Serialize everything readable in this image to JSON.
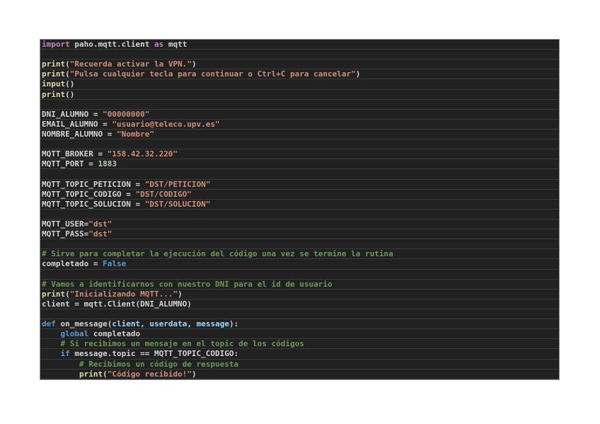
{
  "page": {
    "background": "#ffffff"
  },
  "editor": {
    "language": "python",
    "background": "#212121",
    "rule_color": "#3a3a3a",
    "border_color": "#8f8f8f",
    "colors": {
      "plain": "#d4d4d4",
      "keyword": "#c586c0",
      "control": "#569cd6",
      "function": "#dcdcaa",
      "string": "#ce9178",
      "number": "#b5cea8",
      "comment": "#6a9955",
      "param": "#9cdcfe"
    },
    "lines": [
      {
        "s": [
          [
            "import",
            "keyword"
          ],
          [
            " paho.mqtt.client ",
            "plain"
          ],
          [
            "as",
            "keyword"
          ],
          [
            " mqtt",
            "plain"
          ]
        ]
      },
      {
        "s": []
      },
      {
        "s": [
          [
            "print",
            "function"
          ],
          [
            "(",
            "plain"
          ],
          [
            "\"Recuerda activar la VPN.\"",
            "string"
          ],
          [
            ")",
            "plain"
          ]
        ]
      },
      {
        "s": [
          [
            "print",
            "function"
          ],
          [
            "(",
            "plain"
          ],
          [
            "\"Pulsa cualquier tecla para continuar o Ctrl+C para cancelar\"",
            "string"
          ],
          [
            ")",
            "plain"
          ]
        ]
      },
      {
        "s": [
          [
            "input",
            "function"
          ],
          [
            "()",
            "plain"
          ]
        ]
      },
      {
        "s": [
          [
            "print",
            "function"
          ],
          [
            "()",
            "plain"
          ]
        ]
      },
      {
        "s": []
      },
      {
        "s": [
          [
            "DNI_ALUMNO = ",
            "plain"
          ],
          [
            "\"00000000\"",
            "string"
          ]
        ]
      },
      {
        "s": [
          [
            "EMAIL_ALUMNO = ",
            "plain"
          ],
          [
            "\"usuario@teleco.upv.es\"",
            "string"
          ]
        ]
      },
      {
        "s": [
          [
            "NOMBRE_ALUMNO = ",
            "plain"
          ],
          [
            "\"Nombre\"",
            "string"
          ]
        ]
      },
      {
        "s": []
      },
      {
        "s": [
          [
            "MQTT_BROKER = ",
            "plain"
          ],
          [
            "\"158.42.32.220\"",
            "string"
          ]
        ]
      },
      {
        "s": [
          [
            "MQTT_PORT = ",
            "plain"
          ],
          [
            "1883",
            "number"
          ]
        ]
      },
      {
        "s": []
      },
      {
        "s": [
          [
            "MQTT_TOPIC_PETICION = ",
            "plain"
          ],
          [
            "\"DST/PETICION\"",
            "string"
          ]
        ]
      },
      {
        "s": [
          [
            "MQTT_TOPIC_CODIGO = ",
            "plain"
          ],
          [
            "\"DST/CODIGO\"",
            "string"
          ]
        ]
      },
      {
        "s": [
          [
            "MQTT_TOPIC_SOLUCION = ",
            "plain"
          ],
          [
            "\"DST/SOLUCION\"",
            "string"
          ]
        ]
      },
      {
        "s": []
      },
      {
        "s": [
          [
            "MQTT_USER=",
            "plain"
          ],
          [
            "\"dst\"",
            "string"
          ]
        ]
      },
      {
        "s": [
          [
            "MQTT_PASS=",
            "plain"
          ],
          [
            "\"dst\"",
            "string"
          ]
        ]
      },
      {
        "s": []
      },
      {
        "s": [
          [
            "# Sirve para completar la ejecución del código una vez se termine la rutina",
            "comment"
          ]
        ]
      },
      {
        "s": [
          [
            "completado = ",
            "plain"
          ],
          [
            "False",
            "control"
          ]
        ]
      },
      {
        "s": []
      },
      {
        "s": [
          [
            "# Vamos a identificarnos con nuestro DNI para el id de usuario",
            "comment"
          ]
        ]
      },
      {
        "s": [
          [
            "print",
            "function"
          ],
          [
            "(",
            "plain"
          ],
          [
            "\"Inicializando MQTT...\"",
            "string"
          ],
          [
            ")",
            "plain"
          ]
        ]
      },
      {
        "s": [
          [
            "client = mqtt.Client(DNI_ALUMNO)",
            "plain"
          ]
        ]
      },
      {
        "s": []
      },
      {
        "s": [
          [
            "def",
            "control"
          ],
          [
            " ",
            "plain"
          ],
          [
            "on_message",
            "plain"
          ],
          [
            "(",
            "plain"
          ],
          [
            "client",
            "param"
          ],
          [
            ", ",
            "plain"
          ],
          [
            "userdata",
            "param"
          ],
          [
            ", ",
            "plain"
          ],
          [
            "message",
            "param"
          ],
          [
            "):",
            "plain"
          ]
        ]
      },
      {
        "s": [
          [
            "    ",
            "plain"
          ],
          [
            "global",
            "control"
          ],
          [
            " completado",
            "plain"
          ]
        ]
      },
      {
        "s": [
          [
            "    # Si recibimos un mensaje en el topic de los códigos",
            "comment"
          ]
        ]
      },
      {
        "s": [
          [
            "    ",
            "plain"
          ],
          [
            "if",
            "control"
          ],
          [
            " message.topic == MQTT_TOPIC_CODIGO:",
            "plain"
          ]
        ]
      },
      {
        "s": [
          [
            "        # Recibimos un código de respuesta",
            "comment"
          ]
        ]
      },
      {
        "s": [
          [
            "        ",
            "plain"
          ],
          [
            "print",
            "function"
          ],
          [
            "(",
            "plain"
          ],
          [
            "\"Código recibido!\"",
            "string"
          ],
          [
            ")",
            "plain"
          ]
        ]
      }
    ]
  }
}
